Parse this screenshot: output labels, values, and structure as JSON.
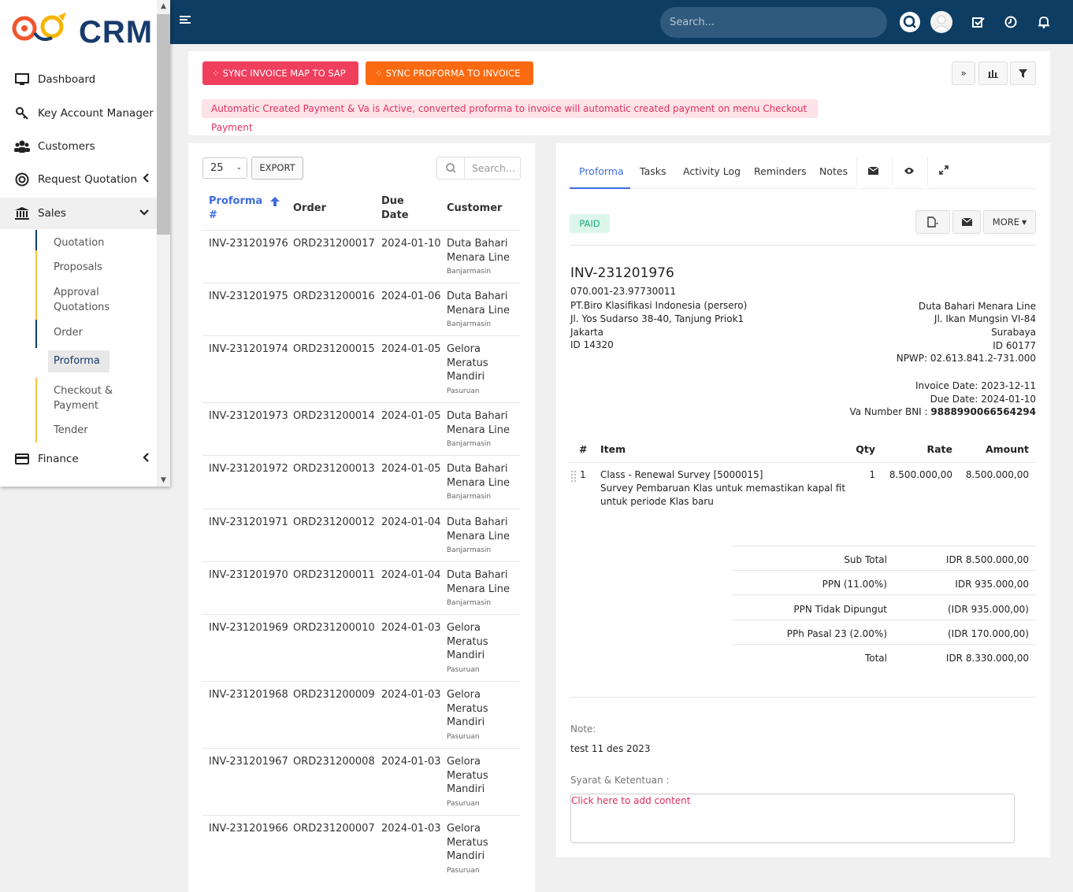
{
  "sidebar": {
    "logo_text": "CRM",
    "items": [
      {
        "label": "Dashboard"
      },
      {
        "label": "Key Account Manager"
      },
      {
        "label": "Customers"
      },
      {
        "label": "Request Quotation"
      },
      {
        "label": "Sales"
      },
      {
        "label": "Finance"
      }
    ],
    "sales_sub": [
      "Quotation",
      "Proposals",
      "Approval Quotations",
      "Order",
      "Proforma",
      "Checkout & Payment",
      "Tender"
    ]
  },
  "topbar": {
    "search_placeholder": "Search..."
  },
  "actions": {
    "sync_sap": "SYNC INVOICE MAP TO SAP",
    "sync_proforma": "SYNC PROFORMA TO INVOICE",
    "alert": "Automatic Created Payment & Va is Active, converted proforma to invoice will automatic created payment on menu Checkout Payment"
  },
  "list": {
    "page_size": "25",
    "export": "EXPORT",
    "search_placeholder": "Search...",
    "headers": {
      "proforma_a": "Proforma",
      "proforma_b": "#",
      "order": "Order",
      "due_a": "Due",
      "due_b": "Date",
      "customer": "Customer"
    },
    "rows": [
      {
        "inv": "INV-231201976",
        "ord": "ORD231200017",
        "due": "2024-01-10",
        "cust": [
          "Duta Bahari",
          "Menara Line"
        ],
        "city": "Banjarmasin"
      },
      {
        "inv": "INV-231201975",
        "ord": "ORD231200016",
        "due": "2024-01-06",
        "cust": [
          "Duta Bahari",
          "Menara Line"
        ],
        "city": "Banjarmasin"
      },
      {
        "inv": "INV-231201974",
        "ord": "ORD231200015",
        "due": "2024-01-05",
        "cust": [
          "Gelora",
          "Meratus",
          "Mandiri"
        ],
        "city": "Pasuruan"
      },
      {
        "inv": "INV-231201973",
        "ord": "ORD231200014",
        "due": "2024-01-05",
        "cust": [
          "Duta Bahari",
          "Menara Line"
        ],
        "city": "Banjarmasin"
      },
      {
        "inv": "INV-231201972",
        "ord": "ORD231200013",
        "due": "2024-01-05",
        "cust": [
          "Duta Bahari",
          "Menara Line"
        ],
        "city": "Banjarmasin"
      },
      {
        "inv": "INV-231201971",
        "ord": "ORD231200012",
        "due": "2024-01-04",
        "cust": [
          "Duta Bahari",
          "Menara Line"
        ],
        "city": "Banjarmasin"
      },
      {
        "inv": "INV-231201970",
        "ord": "ORD231200011",
        "due": "2024-01-04",
        "cust": [
          "Duta Bahari",
          "Menara Line"
        ],
        "city": "Banjarmasin"
      },
      {
        "inv": "INV-231201969",
        "ord": "ORD231200010",
        "due": "2024-01-03",
        "cust": [
          "Gelora",
          "Meratus",
          "Mandiri"
        ],
        "city": "Pasuruan"
      },
      {
        "inv": "INV-231201968",
        "ord": "ORD231200009",
        "due": "2024-01-03",
        "cust": [
          "Gelora",
          "Meratus",
          "Mandiri"
        ],
        "city": "Pasuruan"
      },
      {
        "inv": "INV-231201967",
        "ord": "ORD231200008",
        "due": "2024-01-03",
        "cust": [
          "Gelora",
          "Meratus",
          "Mandiri"
        ],
        "city": "Pasuruan"
      },
      {
        "inv": "INV-231201966",
        "ord": "ORD231200007",
        "due": "2024-01-03",
        "cust": [
          "Gelora",
          "Meratus",
          "Mandiri"
        ],
        "city": "Pasuruan"
      }
    ]
  },
  "detail": {
    "tabs": [
      "Proforma",
      "Tasks",
      "Activity Log",
      "Reminders",
      "Notes"
    ],
    "status": "PAID",
    "more": "MORE",
    "invoice_no": "INV-231201976",
    "ref": "070.001-23.97730011",
    "from": [
      "PT.Biro Klasifikasi Indonesia (persero)",
      "Jl. Yos Sudarso 38-40, Tanjung Priok1",
      "Jakarta",
      "ID 14320"
    ],
    "to": [
      "Duta Bahari Menara Line",
      "Jl. Ikan Mungsin VI-84",
      "Surabaya",
      "ID 60177",
      "NPWP: 02.613.841.2-731.000"
    ],
    "invoice_date": "Invoice Date: 2023-12-11",
    "due_date": "Due Date: 2024-01-10",
    "va_label": "Va Number BNI :",
    "va_number": "9888990066564294",
    "items_header": {
      "num": "#",
      "item": "Item",
      "qty": "Qty",
      "rate": "Rate",
      "amount": "Amount"
    },
    "item": {
      "num": "1",
      "name": "Class - Renewal Survey [5000015]",
      "desc1": "Survey Pembaruan Klas untuk memastikan kapal fit",
      "desc2": "untuk periode Klas baru",
      "qty": "1",
      "rate": "8.500.000,00",
      "amount": "8.500.000,00"
    },
    "totals": [
      {
        "label": "Sub Total",
        "value": "IDR 8.500.000,00"
      },
      {
        "label": "PPN (11.00%)",
        "value": "IDR 935.000,00"
      },
      {
        "label": "PPN Tidak Dipungut",
        "value": "(IDR 935.000,00)"
      },
      {
        "label": "PPh Pasal 23 (2.00%)",
        "value": "(IDR 170.000,00)"
      },
      {
        "label": "Total",
        "value": "IDR 8.330.000,00"
      }
    ],
    "note_label": "Note:",
    "note_text": "test 11 des 2023",
    "terms_label": "Syarat & Ketentuan :",
    "terms_placeholder": "Click here to add content"
  },
  "colors": {
    "topbar": "#0d3d63",
    "accent": "#3d6be0",
    "red": "#f03e5d",
    "orange": "#fb6a11"
  }
}
